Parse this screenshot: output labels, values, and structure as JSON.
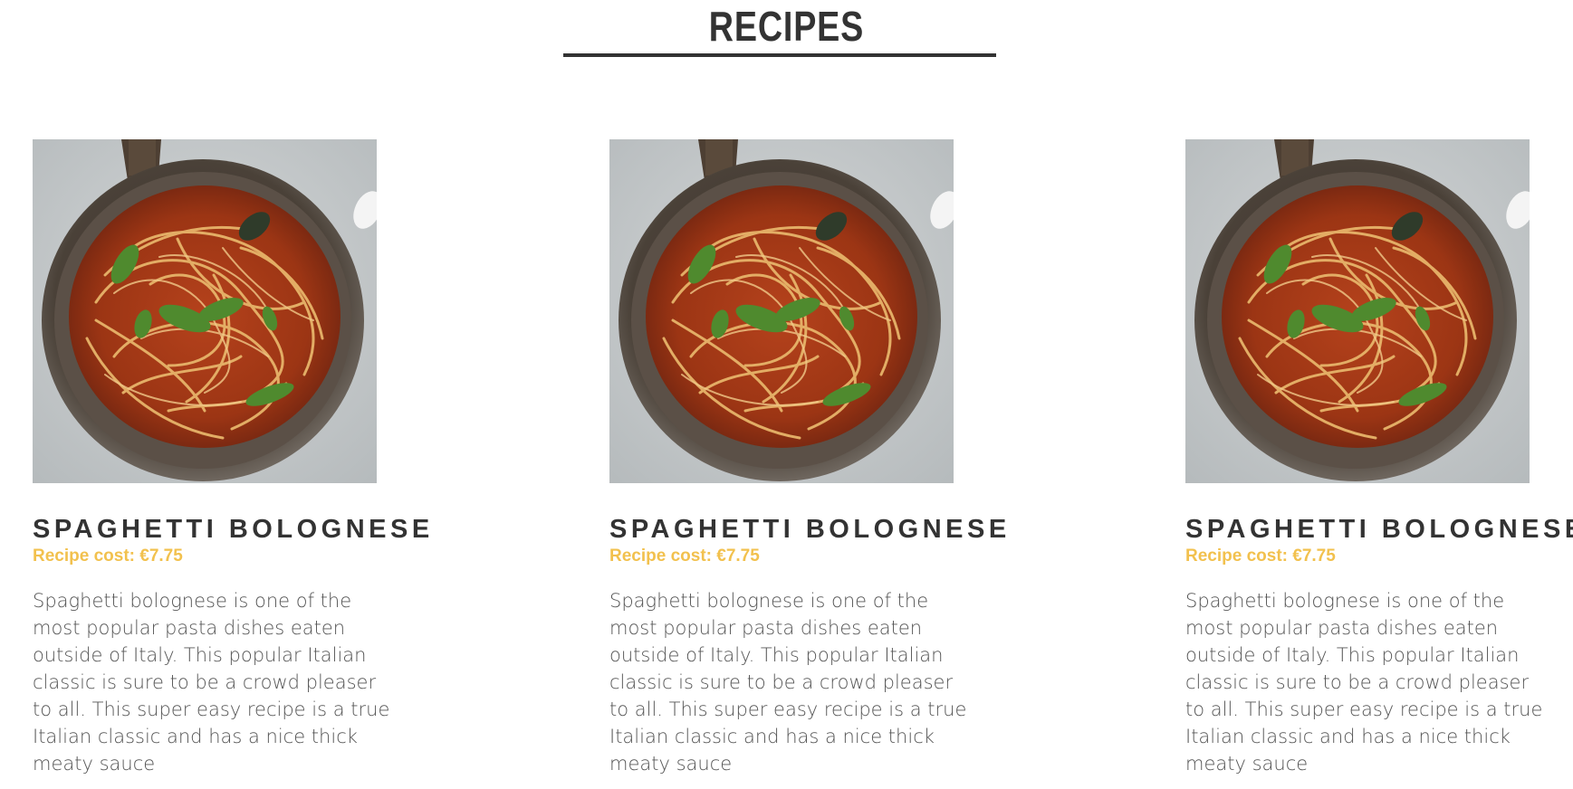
{
  "page": {
    "title": "RECIPES"
  },
  "colors": {
    "heading": "#333333",
    "accent": "#f2c14e",
    "body_text": "#555555"
  },
  "recipes": [
    {
      "image": "spaghetti-bolognese-photo",
      "name": "SPAGHETTI BOLOGNESE",
      "cost": "Recipe cost: €7.75",
      "description": "Spaghetti bolognese is one of the most popular pasta dishes eaten outside of Italy. This popular Italian classic is sure to be a crowd pleaser to all. This super easy recipe is a true Italian classic and has a nice thick meaty sauce"
    },
    {
      "image": "spaghetti-bolognese-photo",
      "name": "SPAGHETTI BOLOGNESE",
      "cost": "Recipe cost: €7.75",
      "description": "Spaghetti bolognese is one of the most popular pasta dishes eaten outside of Italy. This popular Italian classic is sure to be a crowd pleaser to all. This super easy recipe is a true Italian classic and has a nice thick meaty sauce"
    },
    {
      "image": "spaghetti-bolognese-photo",
      "name": "SPAGHETTI BOLOGNESE",
      "cost": "Recipe cost: €7.75",
      "description": "Spaghetti bolognese is one of the most popular pasta dishes eaten outside of Italy. This popular Italian classic is sure to be a crowd pleaser to all. This super easy recipe is a true Italian classic and has a nice thick meaty sauce"
    }
  ]
}
